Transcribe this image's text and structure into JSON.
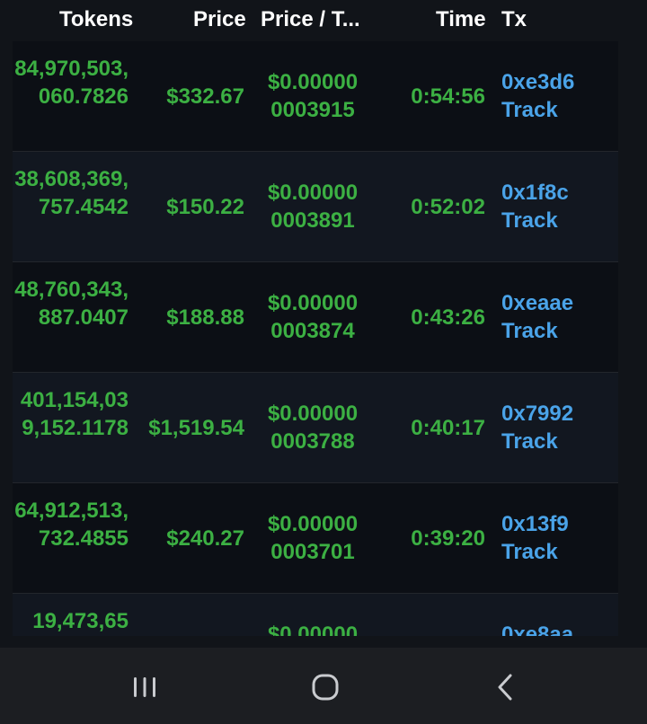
{
  "header": {
    "tokens": "Tokens",
    "price": "Price",
    "price_per_token": "Price / T...",
    "time": "Time",
    "tx": "Tx"
  },
  "rows": [
    {
      "tokens": "84,970,503,060.7826",
      "price": "$332.67",
      "price_per_token": "$0.000000003915",
      "time": "0:54:56",
      "tx": "0xe3d6",
      "track": "Track"
    },
    {
      "tokens": "38,608,369,757.4542",
      "price": "$150.22",
      "price_per_token": "$0.000000003891",
      "time": "0:52:02",
      "tx": "0x1f8c",
      "track": "Track"
    },
    {
      "tokens": "48,760,343,887.0407",
      "price": "$188.88",
      "price_per_token": "$0.000000003874",
      "time": "0:43:26",
      "tx": "0xeaae",
      "track": "Track"
    },
    {
      "tokens": "401,154,039,152.1178",
      "price": "$1,519.54",
      "price_per_token": "$0.000000003788",
      "time": "0:40:17",
      "tx": "0x7992",
      "track": "Track"
    },
    {
      "tokens": "64,912,513,732.4855",
      "price": "$240.27",
      "price_per_token": "$0.000000003701",
      "time": "0:39:20",
      "tx": "0x13f9",
      "track": "Track"
    },
    {
      "tokens": "19,473,65",
      "price": "",
      "price_per_token": "$0.00000",
      "time": "",
      "tx": "0xe8aa",
      "track": ""
    }
  ],
  "colors": {
    "green": "#3cb043",
    "link": "#4aa3e8",
    "header_text": "#ffffff"
  },
  "navbar": {
    "recent_icon": "recent-apps-icon",
    "home_icon": "home-icon",
    "back_icon": "back-icon"
  }
}
